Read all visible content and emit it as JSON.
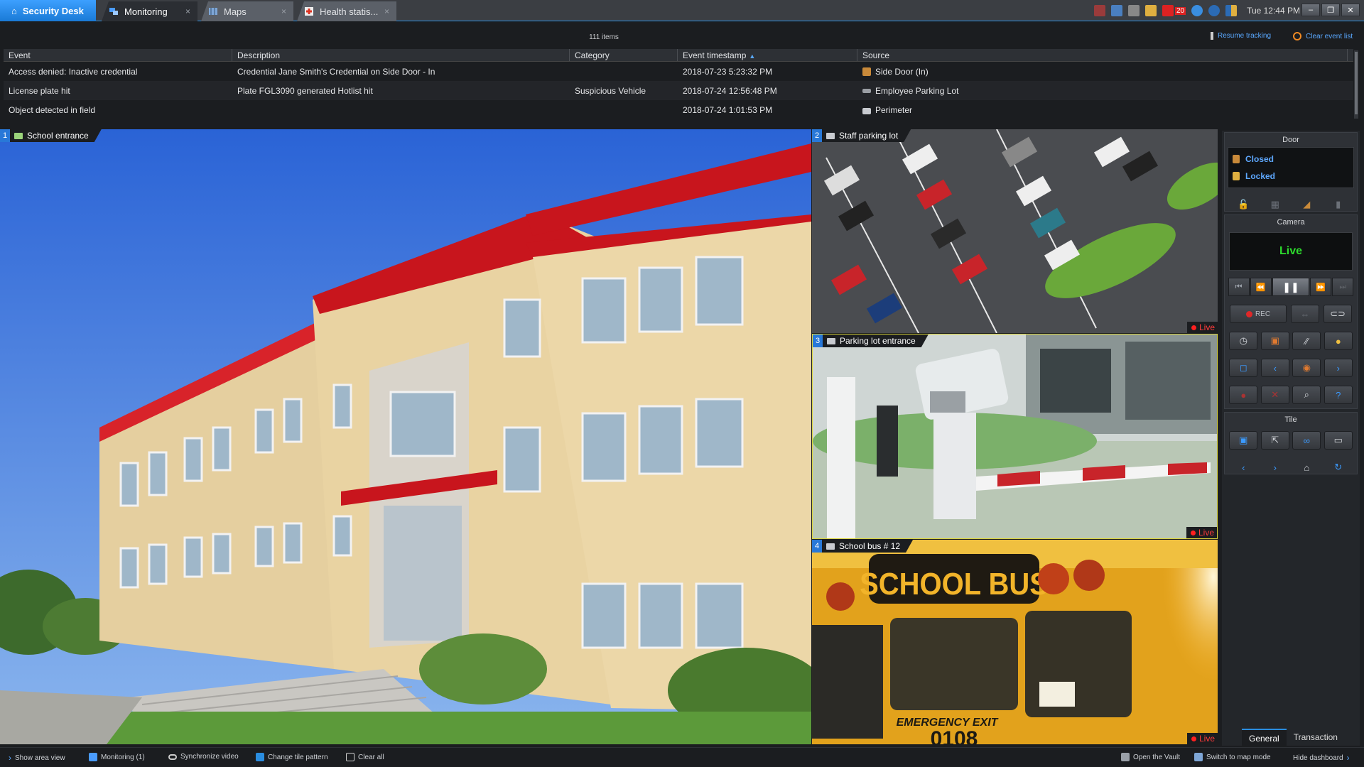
{
  "titlebar": {
    "brand": "Security Desk",
    "tabs": [
      {
        "label": "Monitoring",
        "close": "×"
      },
      {
        "label": "Maps",
        "close": "×"
      },
      {
        "label": "Health statis...",
        "close": "×"
      }
    ],
    "alarm_count": "20",
    "clock": "Tue 12:44 PM"
  },
  "events": {
    "count": "111 items",
    "resume_tracking": "Resume tracking",
    "clear_list": "Clear event list",
    "columns": [
      "Event",
      "Description",
      "Category",
      "Event timestamp",
      "Source"
    ],
    "rows": [
      {
        "event": "Access denied: Inactive credential",
        "description": "Credential Jane Smith's Credential on Side Door - In",
        "category": "",
        "timestamp": "2018-07-23 5:23:32 PM",
        "source": "Side Door (In)",
        "source_icon": "door-icon"
      },
      {
        "event": "License plate hit",
        "description": "Plate FGL3090 generated Hotlist hit",
        "category": "Suspicious Vehicle",
        "timestamp": "2018-07-24 12:56:48 PM",
        "source": "Employee Parking Lot",
        "source_icon": "lpr-camera-icon"
      },
      {
        "event": "Object detected in field",
        "description": "",
        "category": "",
        "timestamp": "2018-07-24 1:01:53 PM",
        "source": "Perimeter",
        "source_icon": "camera-icon"
      }
    ]
  },
  "tiles": [
    {
      "number": "1",
      "name": "School entrance"
    },
    {
      "number": "2",
      "name": "Staff parking lot",
      "status": "Live"
    },
    {
      "number": "3",
      "name": "Parking lot entrance",
      "status": "Live"
    },
    {
      "number": "4",
      "name": "School bus # 12",
      "status": "Live"
    }
  ],
  "dashboard": {
    "door_title": "Door",
    "door_states": [
      "Closed",
      "Locked"
    ],
    "camera_title": "Camera",
    "camera_status": "Live",
    "rec_label": "REC",
    "tile_title": "Tile",
    "tabs": [
      "General",
      "Transaction"
    ]
  },
  "bottombar": {
    "show_area_view": "Show area view",
    "monitoring": "Monitoring (1)",
    "sync_video": "Synchronize video",
    "change_tile": "Change tile pattern",
    "clear_all": "Clear all",
    "open_vault": "Open the Vault",
    "switch_map": "Switch to map mode",
    "hide_dashboard": "Hide dashboard"
  },
  "colors": {
    "accent": "#2a8de0",
    "live_red": "#ff3b3b",
    "live_green": "#2ddc2d",
    "door_state_blue": "#5ea8ff"
  }
}
